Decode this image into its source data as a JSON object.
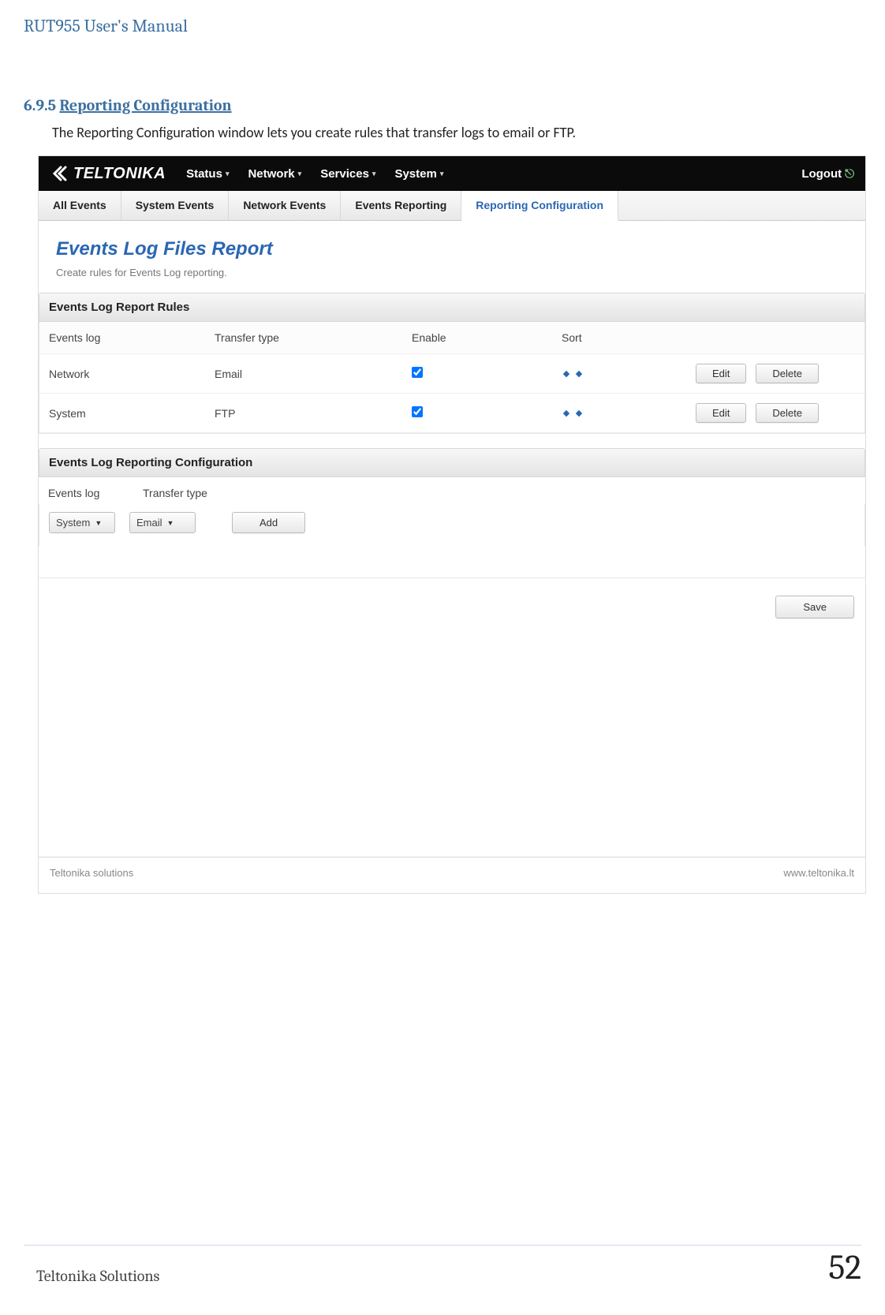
{
  "doc": {
    "header": "RUT955 User's Manual",
    "section_number": "6.9.5",
    "section_title": "Reporting Configuration",
    "intro": "The Reporting Configuration window lets you create rules that transfer logs to email or FTP.",
    "footer_left": "Teltonika Solutions",
    "page_number": "52"
  },
  "topbar": {
    "brand": "TELTONIKA",
    "nav": [
      "Status",
      "Network",
      "Services",
      "System"
    ],
    "logout": "Logout"
  },
  "tabs": {
    "items": [
      "All Events",
      "System Events",
      "Network Events",
      "Events Reporting",
      "Reporting Configuration"
    ],
    "active_index": 4
  },
  "page": {
    "title": "Events Log Files Report",
    "subtitle": "Create rules for Events Log reporting."
  },
  "rules": {
    "section_title": "Events Log Report Rules",
    "columns": {
      "events": "Events log",
      "transfer": "Transfer type",
      "enable": "Enable",
      "sort": "Sort"
    },
    "rows": [
      {
        "events": "Network",
        "transfer": "Email",
        "enabled": true,
        "edit": "Edit",
        "delete": "Delete"
      },
      {
        "events": "System",
        "transfer": "FTP",
        "enabled": true,
        "edit": "Edit",
        "delete": "Delete"
      }
    ]
  },
  "config": {
    "section_title": "Events Log Reporting Configuration",
    "labels": {
      "events": "Events log",
      "transfer": "Transfer type"
    },
    "events_select": "System",
    "transfer_select": "Email",
    "add_label": "Add"
  },
  "save": {
    "label": "Save"
  },
  "footer": {
    "left": "Teltonika solutions",
    "right": "www.teltonika.lt"
  }
}
